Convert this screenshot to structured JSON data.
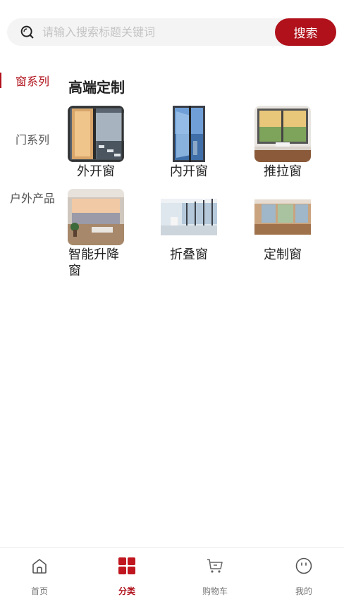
{
  "search": {
    "placeholder": "请输入搜索标题关键词",
    "value": "",
    "button_label": "搜索"
  },
  "sidebar": {
    "items": [
      {
        "label": "窗系列",
        "active": true
      },
      {
        "label": "门系列",
        "active": false
      },
      {
        "label": "户外产品",
        "active": false
      }
    ]
  },
  "main": {
    "section_title": "高端定制",
    "products": [
      {
        "label": "外开窗"
      },
      {
        "label": "内开窗"
      },
      {
        "label": "推拉窗"
      },
      {
        "label": "智能升降窗"
      },
      {
        "label": "折叠窗"
      },
      {
        "label": "定制窗"
      }
    ]
  },
  "tabbar": {
    "tabs": [
      {
        "label": "首页",
        "icon": "home-icon"
      },
      {
        "label": "分类",
        "icon": "category-grid-icon",
        "active": true
      },
      {
        "label": "购物车",
        "icon": "cart-icon"
      },
      {
        "label": "我的",
        "icon": "profile-face-icon"
      }
    ]
  },
  "colors": {
    "accent": "#b0111b",
    "search_bg": "#f4f4f4",
    "inactive_text": "#777777"
  }
}
